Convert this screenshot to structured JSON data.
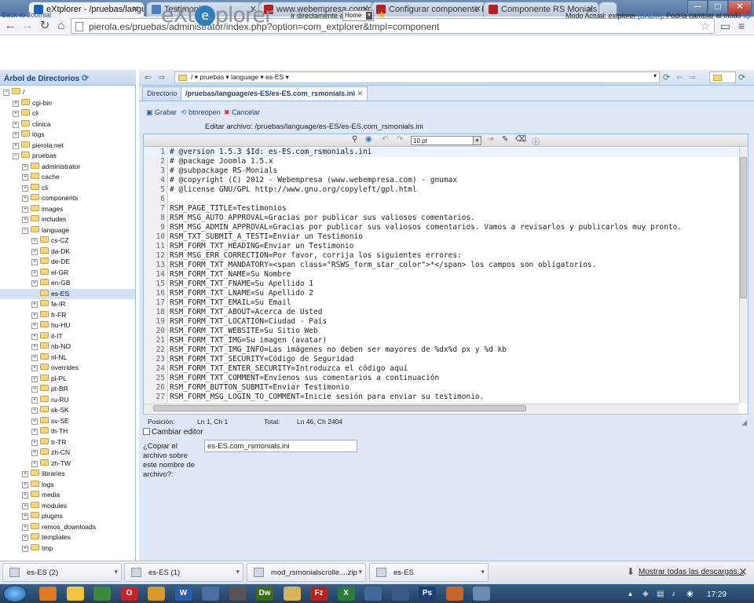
{
  "browser": {
    "tabs": [
      {
        "label": "eXtplorer - /pruebas/langu",
        "icon_color": "#1b63b5",
        "active": true
      },
      {
        "label": "Testimonios",
        "icon_color": "#4a7fc0",
        "active": false
      },
      {
        "label": "www.webempresa.com/re",
        "icon_color": "#b52020",
        "active": false
      },
      {
        "label": "Configurar componente R",
        "icon_color": "#b52020",
        "active": false
      },
      {
        "label": "Componente RS Monials",
        "icon_color": "#b52020",
        "active": false
      }
    ],
    "window_buttons": [
      "─",
      "□",
      "✕"
    ],
    "url": "pierola.es/pruebas/administrator/index.php?option=com_extplorer&tmpl=component"
  },
  "header": {
    "back_link": "Back to Joomla!",
    "logo_left": "eXt",
    "logo_mid": "e",
    "logo_right": "plorer",
    "goto_label": "Ir directamente a:",
    "goto_value": "Home",
    "mode_prefix": "Modo Actual: extplorer",
    "mode_exit": "[SALIR]",
    "mode_mid": ". Podría cambiar al modo",
    "mode_ftp": "ftp"
  },
  "tree": {
    "title": "Árbol de Directorios",
    "items": [
      {
        "label": "/",
        "depth": 0,
        "expander": "−"
      },
      {
        "label": "cgi-bin",
        "depth": 1,
        "expander": "+"
      },
      {
        "label": "cli",
        "depth": 1,
        "expander": "+"
      },
      {
        "label": "clinica",
        "depth": 1,
        "expander": "+"
      },
      {
        "label": "logs",
        "depth": 1,
        "expander": "+"
      },
      {
        "label": "pierola.net",
        "depth": 1,
        "expander": "+"
      },
      {
        "label": "pruebas",
        "depth": 1,
        "expander": "−"
      },
      {
        "label": "administrator",
        "depth": 2,
        "expander": "+"
      },
      {
        "label": "cache",
        "depth": 2,
        "expander": "+"
      },
      {
        "label": "cli",
        "depth": 2,
        "expander": "+"
      },
      {
        "label": "components",
        "depth": 2,
        "expander": "+"
      },
      {
        "label": "images",
        "depth": 2,
        "expander": "+"
      },
      {
        "label": "includes",
        "depth": 2,
        "expander": "+"
      },
      {
        "label": "language",
        "depth": 2,
        "expander": "−"
      },
      {
        "label": "cs-CZ",
        "depth": 3,
        "expander": "+"
      },
      {
        "label": "da-DK",
        "depth": 3,
        "expander": "+"
      },
      {
        "label": "de-DE",
        "depth": 3,
        "expander": "+"
      },
      {
        "label": "el-GR",
        "depth": 3,
        "expander": "+"
      },
      {
        "label": "en-GB",
        "depth": 3,
        "expander": "+"
      },
      {
        "label": "es-ES",
        "depth": 3,
        "expander": "",
        "selected": true
      },
      {
        "label": "fa-IR",
        "depth": 3,
        "expander": "+"
      },
      {
        "label": "fr-FR",
        "depth": 3,
        "expander": "+"
      },
      {
        "label": "hu-HU",
        "depth": 3,
        "expander": "+"
      },
      {
        "label": "it-IT",
        "depth": 3,
        "expander": "+"
      },
      {
        "label": "nb-NO",
        "depth": 3,
        "expander": "+"
      },
      {
        "label": "nl-NL",
        "depth": 3,
        "expander": "+"
      },
      {
        "label": "overrides",
        "depth": 3,
        "expander": "+"
      },
      {
        "label": "pl-PL",
        "depth": 3,
        "expander": "+"
      },
      {
        "label": "pt-BR",
        "depth": 3,
        "expander": "+"
      },
      {
        "label": "ru-RU",
        "depth": 3,
        "expander": "+"
      },
      {
        "label": "sk-SK",
        "depth": 3,
        "expander": "+"
      },
      {
        "label": "sv-SE",
        "depth": 3,
        "expander": "+"
      },
      {
        "label": "th-TH",
        "depth": 3,
        "expander": "+"
      },
      {
        "label": "tr-TR",
        "depth": 3,
        "expander": "+"
      },
      {
        "label": "zh-CN",
        "depth": 3,
        "expander": "+"
      },
      {
        "label": "zh-TW",
        "depth": 3,
        "expander": "+"
      },
      {
        "label": "libraries",
        "depth": 2,
        "expander": "+"
      },
      {
        "label": "logs",
        "depth": 2,
        "expander": "+"
      },
      {
        "label": "media",
        "depth": 2,
        "expander": "+"
      },
      {
        "label": "modules",
        "depth": 2,
        "expander": "+"
      },
      {
        "label": "plugins",
        "depth": 2,
        "expander": "+"
      },
      {
        "label": "remos_downloads",
        "depth": 2,
        "expander": "+"
      },
      {
        "label": "templates",
        "depth": 2,
        "expander": "+"
      },
      {
        "label": "tmp",
        "depth": 2,
        "expander": "+"
      }
    ]
  },
  "dirbar": {
    "path": "/ ▾  pruebas ▾  language ▾  es-ES ▾"
  },
  "tabs": {
    "directory": "Directorio",
    "file": "/pruebas/language/es-ES/es-ES.com_rsmonials.ini",
    "close": "✕"
  },
  "editbar": {
    "save": "Grabar",
    "reopen": "btnreopen",
    "cancel": "Cancelar",
    "edit_label": "Editar archivo: /pruebas/language/es-ES/es-ES.com_rsmonials.ini"
  },
  "editor": {
    "font_size": "10 pt",
    "lines": [
      "# @version 1.5.3 $Id: es-ES.com_rsmonials.ini",
      "# @package Joomla 1.5.x",
      "# @subpackage RS-Monials",
      "# @copyright (C) 2012 - Webempresa (www.webempresa.com) - gnumax",
      "# @license GNU/GPL http://www.gnu.org/copyleft/gpl.html",
      "",
      "RSM_PAGE_TITLE=Testimonios",
      "RSM_MSG_AUTO_APPROVAL=Gracias por publicar sus valiosos comentarios.",
      "RSM_MSG_ADMIN_APPROVAL=Gracias por publicar sus valiosos comentarios. Vamos a revisarlos y publicarlos muy pronto.",
      "RSM_TXT_SUBMIT_A_TESTI=Enviar un Testimonio",
      "RSM_FORM_TXT_HEADING=Enviar un Testimonio",
      "RSM_MSG_ERR_CORRECTION=Por favor, corrija los siguientes errores:",
      "RSM_FORM_TXT_MANDATORY=<span class=\"RSWS_form_star_color\">*</span> los campos son obligatorios.",
      "RSM_FORM_TXT_NAME=Su Nombre",
      "RSM_FORM_TXT_FNAME=Su Apellido 1",
      "RSM_FORM_TXT_LNAME=Su Apellido 2",
      "RSM_FORM_TXT_EMAIL=Su Email",
      "RSM_FORM_TXT_ABOUT=Acerca de Usted",
      "RSM_FORM_TXT_LOCATION=Ciudad - País",
      "RSM_FORM_TXT_WEBSITE=Su Sitio Web",
      "RSM_FORM_TXT_IMG=Su imagen (avatar)",
      "RSM_FORM_TXT_IMG_INFO=Las imágenes no deben ser mayores de %dx%d px y %d kb",
      "RSM_FORM_TXT_SECURITY=Código de Seguridad",
      "RSM_FORM_TXT_ENTER_SECURITY=Introduzca el código aquí",
      "RSM_FORM_TXT_COMMENT=Envíenos sus comentarios a continuación",
      "RSM_FORM_BUTTON_SUBMIT=Enviar Testimonio",
      "RSM_FORM_MSG_LOGIN_TO_COMMENT=Inicie sesión para enviar su testimonio."
    ]
  },
  "status": {
    "position_label": "Posición:",
    "position_value": "Ln 1, Ch 1",
    "total_label": "Total:",
    "total_value": "Ln 46, Ch 2404"
  },
  "options": {
    "change_editor": "Cambiar editor",
    "copy_label": "¿Copiar el archivo sobre este nombre de archivo?:",
    "copy_value": "es-ES.com_rsmonials.ini"
  },
  "downloads": {
    "items": [
      "es-ES (2)",
      "es-ES (1)",
      "mod_rsmonialscrolle....zip",
      "es-ES"
    ],
    "show_all": "Mostrar todas las descargas..."
  },
  "taskbar": {
    "clock": "17:29",
    "apps": [
      {
        "glyph": "",
        "color": "#e07b1f"
      },
      {
        "glyph": "",
        "color": "#f2c33c"
      },
      {
        "glyph": "",
        "color": "#3b8a3b"
      },
      {
        "glyph": "O",
        "color": "#c4242b"
      },
      {
        "glyph": "",
        "color": "#d69a2a"
      },
      {
        "glyph": "W",
        "color": "#2a5ca8"
      },
      {
        "glyph": "",
        "color": "#4a6fa0"
      },
      {
        "glyph": "",
        "color": "#555"
      },
      {
        "glyph": "Dw",
        "color": "#3d6b1e"
      },
      {
        "glyph": "",
        "color": "#d9b35a"
      },
      {
        "glyph": "Fz",
        "color": "#b5231f"
      },
      {
        "glyph": "X",
        "color": "#2a7a3a"
      },
      {
        "glyph": "",
        "color": "#3f6a9a"
      },
      {
        "glyph": "",
        "color": "#3a5a8a"
      },
      {
        "glyph": "Ps",
        "color": "#1f3f73"
      },
      {
        "glyph": "",
        "color": "#c6662a"
      },
      {
        "glyph": "",
        "color": "#6a8ab0"
      }
    ]
  }
}
